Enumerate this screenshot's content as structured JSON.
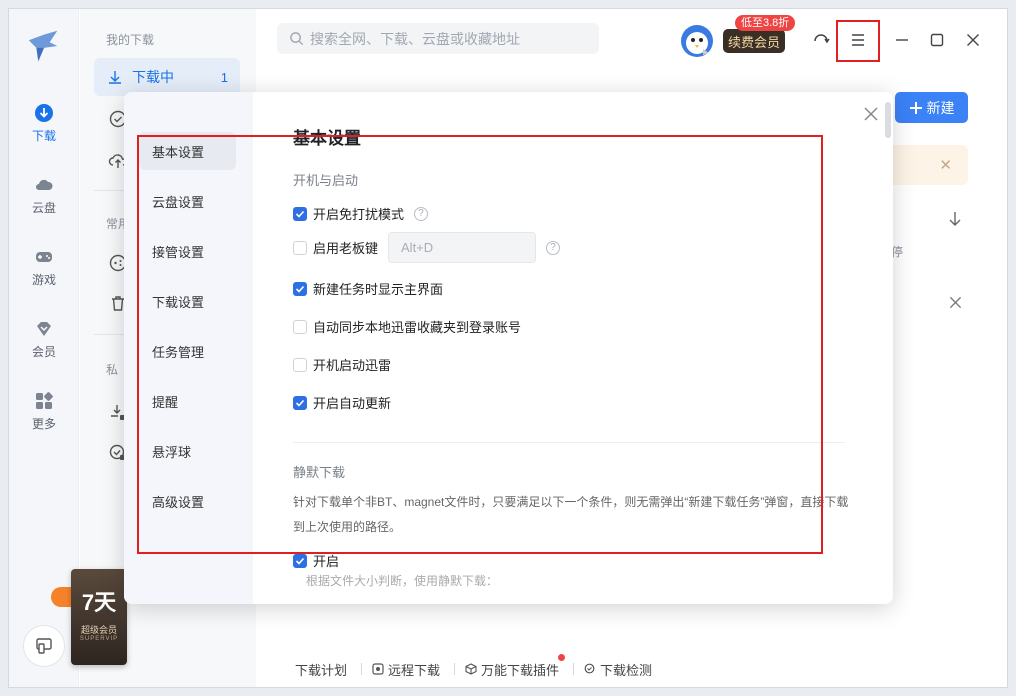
{
  "rail": {
    "items": [
      {
        "label": "下载",
        "icon": "download-icon",
        "active": true
      },
      {
        "label": "云盘",
        "icon": "cloud-icon",
        "active": false
      },
      {
        "label": "游戏",
        "icon": "gamepad-icon",
        "active": false
      },
      {
        "label": "会员",
        "icon": "diamond-icon",
        "active": false
      },
      {
        "label": "更多",
        "icon": "apps-icon",
        "active": false
      }
    ]
  },
  "sidebar": {
    "section_mine": "我的下载",
    "downloading_label": "下载中",
    "downloading_count": "1",
    "section_common_partial": "常用",
    "section_private_partial": "私"
  },
  "promo": {
    "days": "7天",
    "line1": "超级会员",
    "line2": "SUPERVIP"
  },
  "topbar": {
    "search_placeholder": "搜索全网、下载、云盘或收藏地址",
    "renew_label": "续费会员",
    "renew_badge": "低至3.8折"
  },
  "main": {
    "new_button": "新建",
    "partial_text": "停"
  },
  "bottombar": {
    "items": [
      "下载计划",
      "远程下载",
      "万能下载插件",
      "下载检测"
    ]
  },
  "settings": {
    "nav": [
      "基本设置",
      "云盘设置",
      "接管设置",
      "下载设置",
      "任务管理",
      "提醒",
      "悬浮球",
      "高级设置"
    ],
    "title": "基本设置",
    "startup_title": "开机与启动",
    "options": {
      "no_disturb": "开启免打扰模式",
      "boss_key": "启用老板键",
      "boss_key_value": "Alt+D",
      "show_main": "新建任务时显示主界面",
      "sync_favorites": "自动同步本地迅雷收藏夹到登录账号",
      "auto_start": "开机启动迅雷",
      "auto_update": "开启自动更新"
    },
    "silent_title": "静默下载",
    "silent_desc": "针对下载单个非BT、magnet文件时，只要满足以下一个条件，则无需弹出“新建下载任务”弹窗，直接下载到上次使用的路径。",
    "silent_enable": "开启",
    "silent_partial": "根据文件大小判断，使用静默下载："
  },
  "colors": {
    "accent": "#2f6fe4",
    "highlight": "#e02020"
  }
}
